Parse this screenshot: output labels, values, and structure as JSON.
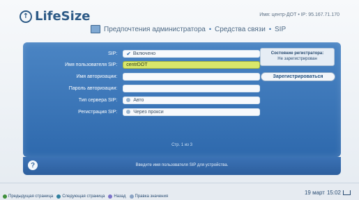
{
  "header": {
    "logo_text": "LifeSize",
    "device_info": "Имя: центр-ДОТ • IP: 95.167.71.170"
  },
  "breadcrumb": {
    "items": [
      "Предпочтения администратора",
      "Средства связи",
      "SIP"
    ],
    "separator": "•"
  },
  "form": {
    "rows": [
      {
        "label": "SIP:",
        "value": "Включено",
        "kind": "checkbox"
      },
      {
        "label": "Имя пользователя SIP:",
        "value": "centrDOT",
        "kind": "text",
        "active": true
      },
      {
        "label": "Имя авторизации:",
        "value": "",
        "kind": "text"
      },
      {
        "label": "Пароль авторизации:",
        "value": "",
        "kind": "text"
      },
      {
        "label": "Тип сервера SIP:",
        "value": "Авто",
        "kind": "select"
      },
      {
        "label": "Регистрация SIP:",
        "value": "Через прокси",
        "kind": "select"
      }
    ]
  },
  "status": {
    "title": "Состояние регистратора:",
    "value": "Не зарегистрирован"
  },
  "register_button": "Зарегистрироваться",
  "page_indicator": "Стр. 1 из 3",
  "help_text": "Введите имя пользователя SIP для устройства.",
  "softkeys": [
    {
      "label": "Предыдущая страница",
      "color": "#3f8f3b"
    },
    {
      "label": "Следующая страница",
      "color": "#2f7f9f"
    },
    {
      "label": "Назад",
      "color": "#7c74c9"
    },
    {
      "label": "Правка значения",
      "color": "#8aa3c4"
    }
  ],
  "clock": {
    "date": "19 март",
    "time": "15:02"
  },
  "colors": {
    "panel_blue": "#2e69ad",
    "active_field": "#d9e76a"
  }
}
